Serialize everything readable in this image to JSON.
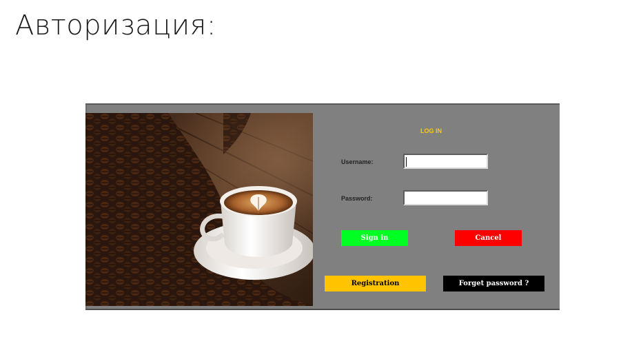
{
  "slide": {
    "title": "Авторизация:"
  },
  "login": {
    "heading": "LOG IN",
    "username_label": "Username:",
    "password_label": "Password:",
    "username_value": "",
    "password_value": "",
    "buttons": {
      "sign_in": "Sign in",
      "cancel": "Cancel",
      "registration": "Registration",
      "forget_password": "Forget password ?"
    }
  },
  "image": {
    "subject": "coffee-cup-with-beans"
  },
  "colors": {
    "panel_background": "#808080",
    "heading": "#ffcc00",
    "sign_in": "#00ff22",
    "cancel": "#ff0000",
    "registration": "#ffc300",
    "forget_password": "#000000"
  }
}
